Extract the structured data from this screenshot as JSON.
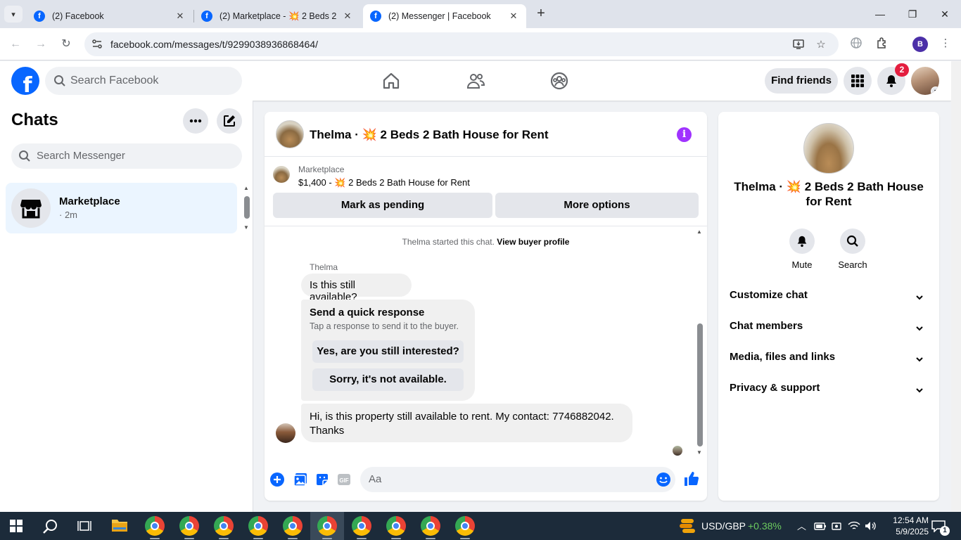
{
  "browser": {
    "tabs": [
      {
        "title": "(2) Facebook",
        "close": "✕"
      },
      {
        "title": "(2) Marketplace - 💥 2 Beds 2 B",
        "close": "✕"
      },
      {
        "title": "(2) Messenger | Facebook",
        "close": "✕"
      }
    ],
    "favicon_letter": "f",
    "url": "facebook.com/messages/t/9299038936868464/",
    "profile_initial": "B"
  },
  "fb": {
    "search_placeholder": "Search Facebook",
    "find_friends": "Find friends",
    "notification_count": "2",
    "brand_color": "#0866ff"
  },
  "sidebar": {
    "title": "Chats",
    "search_placeholder": "Search Messenger",
    "chats": [
      {
        "name": "Marketplace",
        "time": "· 2m"
      }
    ]
  },
  "conversation": {
    "title": "Thelma · 💥 2 Beds 2 Bath House for Rent",
    "marketplace_label": "Marketplace",
    "listing": "$1,400 - 💥 2 Beds 2 Bath House for Rent",
    "mark_pending": "Mark as pending",
    "more_options": "More options",
    "system_prefix": "Thelma started this chat.",
    "system_link": "View buyer profile",
    "sender": "Thelma",
    "msg1": "Is this still available?",
    "quick_title": "Send a quick response",
    "quick_sub": "Tap a response to send it to the buyer.",
    "quick_options": [
      "Yes, are you still interested?",
      "Sorry, it's not available."
    ],
    "msg2_line1": "Hi, is this property still available to rent. My contact: 7746882042.",
    "msg2_line2": "Thanks",
    "composer_placeholder": "Aa"
  },
  "info": {
    "name": "Thelma · 💥 2 Beds 2 Bath House for Rent",
    "actions": [
      {
        "label": "Mute",
        "icon": "bell-icon"
      },
      {
        "label": "Search",
        "icon": "search-icon"
      }
    ],
    "sections": [
      "Customize chat",
      "Chat members",
      "Media, files and links",
      "Privacy & support"
    ]
  },
  "taskbar": {
    "currency_pair": "USD/GBP",
    "currency_change": "+0.38%",
    "time": "12:54 AM",
    "date": "5/9/2025",
    "notification_count": "1"
  }
}
